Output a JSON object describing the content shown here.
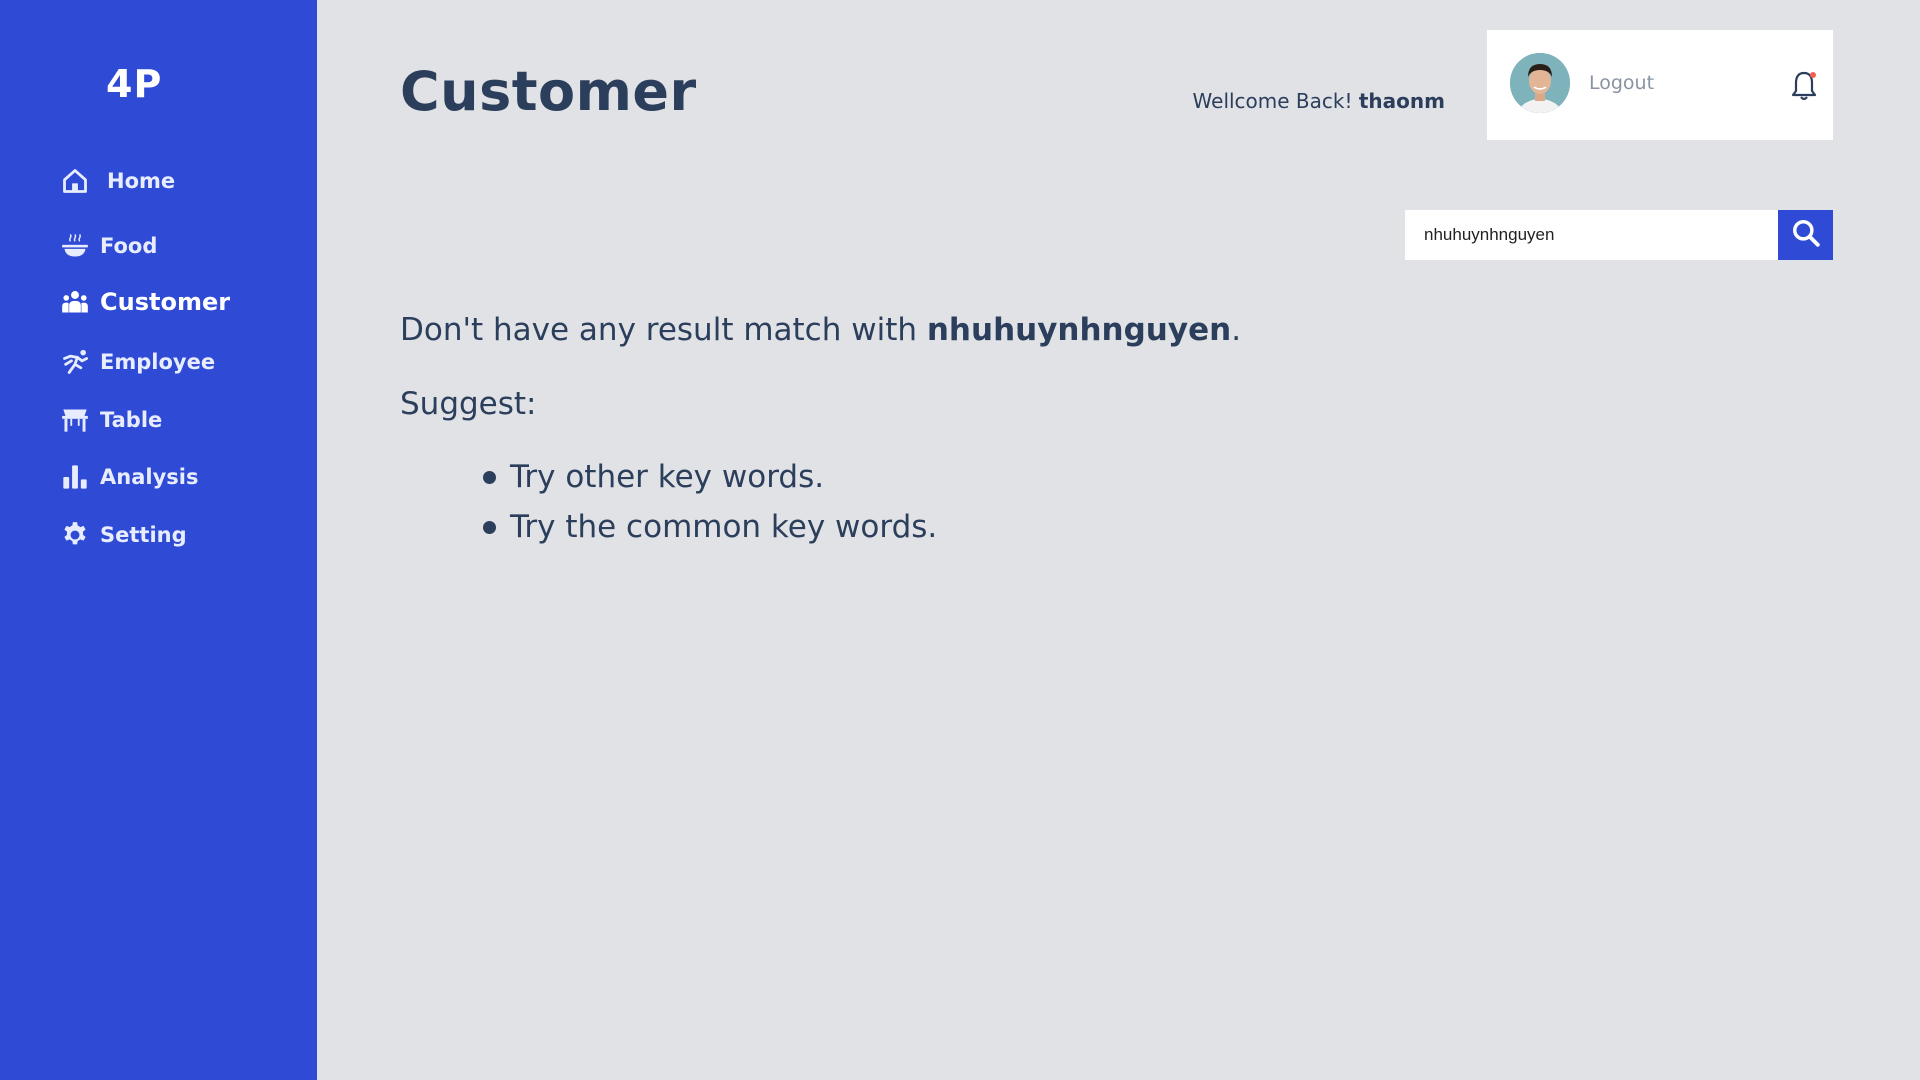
{
  "app": {
    "logo": "4P",
    "accent_color": "#2f4bd6"
  },
  "sidebar": {
    "items": [
      {
        "label": "Home",
        "icon": "home-icon"
      },
      {
        "label": "Food",
        "icon": "food-bowl-icon"
      },
      {
        "label": "Customer",
        "icon": "users-icon",
        "active": true
      },
      {
        "label": "Employee",
        "icon": "employee-icon"
      },
      {
        "label": "Table",
        "icon": "table-icon"
      },
      {
        "label": "Analysis",
        "icon": "bar-chart-icon"
      },
      {
        "label": "Setting",
        "icon": "gear-icon"
      }
    ]
  },
  "header": {
    "title": "Customer",
    "welcome_prefix": "Wellcome Back!",
    "username": "thaonm",
    "logout_label": "Logout"
  },
  "search": {
    "value": "nhuhuynhnguyen"
  },
  "message": {
    "prefix": "Don't have any result match with",
    "keyword": "nhuhuynhnguyen",
    "suffix": ".",
    "suggest_label": "Suggest:",
    "suggestions": [
      "Try other key words.",
      "Try the common key words."
    ]
  }
}
